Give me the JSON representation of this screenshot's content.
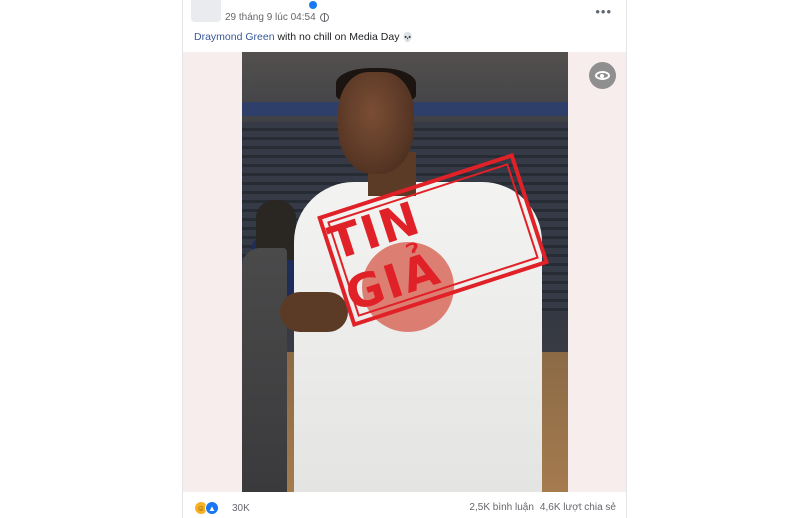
{
  "post": {
    "timestamp": "29 tháng 9 lúc 04:54",
    "caption_tag": "Draymond Green",
    "caption_text": " with no chill on Media Day ",
    "caption_emoji": "💀",
    "more_label": "•••",
    "stamp_text": "TIN GIẢ",
    "reaction_count": "30K",
    "comments": "2,5K bình luận",
    "shares": "4,6K lượt chia sẻ"
  },
  "icons": {
    "verified": "verified-badge-icon",
    "audience": "globe-icon",
    "visibility": "eye-icon",
    "reactions": [
      "haha-reaction-icon",
      "like-reaction-icon"
    ]
  },
  "colors": {
    "link": "#385898",
    "stamp": "#e02228",
    "like": "#1877f2",
    "haha": "#f7b125"
  }
}
